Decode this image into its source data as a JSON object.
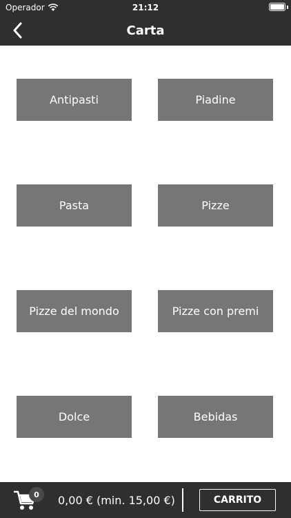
{
  "status_bar": {
    "carrier": "Operador",
    "time": "21:12"
  },
  "navbar": {
    "title": "Carta"
  },
  "categories": [
    "Antipasti",
    "Piadine",
    "Pasta",
    "Pizze",
    "Pizze del mondo",
    "Pizze con premi",
    "Dolce",
    "Bebidas"
  ],
  "cart": {
    "count": "0",
    "total": "0,00 € (min. 15,00 €)",
    "button_label": "CARRITO"
  },
  "colors": {
    "bar_background": "#2f2f2f",
    "button_background": "#767676",
    "text_on_dark": "#ffffff"
  }
}
